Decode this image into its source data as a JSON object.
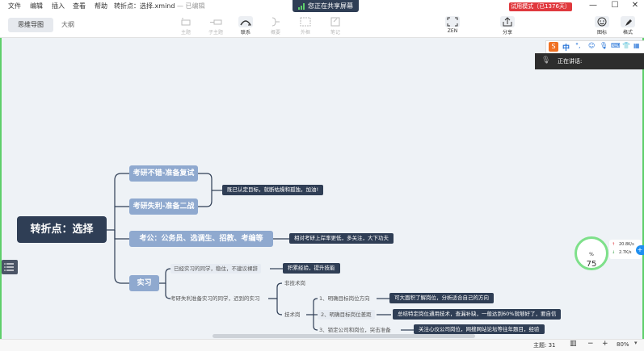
{
  "menu": [
    "文件",
    "编辑",
    "插入",
    "查看",
    "帮助"
  ],
  "file_title": "转折点：选择.xmind",
  "edited_status": "— 已编辑",
  "share_banner": "您正在共享屏幕",
  "trial_badge": "试用模式（已1376天）",
  "view_tabs": {
    "mindmap": "思维导图",
    "outline": "大纲"
  },
  "toolbar": {
    "topic": "主题",
    "subtopic": "子主题",
    "relation": "联系",
    "summary": "概要",
    "boundary": "外框",
    "note": "笔记",
    "zen": "ZEN",
    "share": "分享",
    "icon": "图标",
    "format": "格式"
  },
  "mindmap": {
    "root": "转折点：选择",
    "branches": [
      {
        "label": "考研不错-准备复试"
      },
      {
        "label": "考研失利-准备二战"
      },
      {
        "label": "考公：公务员、选调生、招教、考编等"
      },
      {
        "label": "实习"
      }
    ],
    "notes": {
      "kaoyan": "既已认定目标，就断枯燥和孤独，加油!",
      "kaogong": "相对考研上岸率更低，多关注，大下功夫",
      "shixi_a": "积累经验，提升技能",
      "shixi_b1": "可大面积了解岗位，分析适合自己的方向",
      "shixi_b2": "总结特定岗位通用技术，查漏补缺，一般达到60%就够好了，要自信",
      "shixi_b3": "关注心仪公司岗位，网搜网站论坛等往年题目，经验"
    },
    "sub": {
      "done_intern": "已经实习的同学，稳住，不建议裸辞",
      "prep_intern": "考研失利准备实习的同学，迟到的实习",
      "non_tech": "非技术岗",
      "tech": "技术岗",
      "step1": "1、明确目标岗位方向",
      "step2": "2、明确目标岗位差距",
      "step3": "3、锁定公司和岗位，突击准备"
    }
  },
  "ime": {
    "name": "中",
    "voice_status": "正在讲话:"
  },
  "widgets": {
    "gauge": "75",
    "gauge_unit": "%",
    "up_speed": "20.8K/s",
    "down_speed": "2.7K/s"
  },
  "status": {
    "topic_count": "主题: 31",
    "zoom": "80%"
  },
  "colors": {
    "root": "#2f3e55",
    "branch": "#8fa9cf",
    "note": "#2f3e55",
    "trial": "#e0393e",
    "share_green": "#5fcf6b"
  }
}
